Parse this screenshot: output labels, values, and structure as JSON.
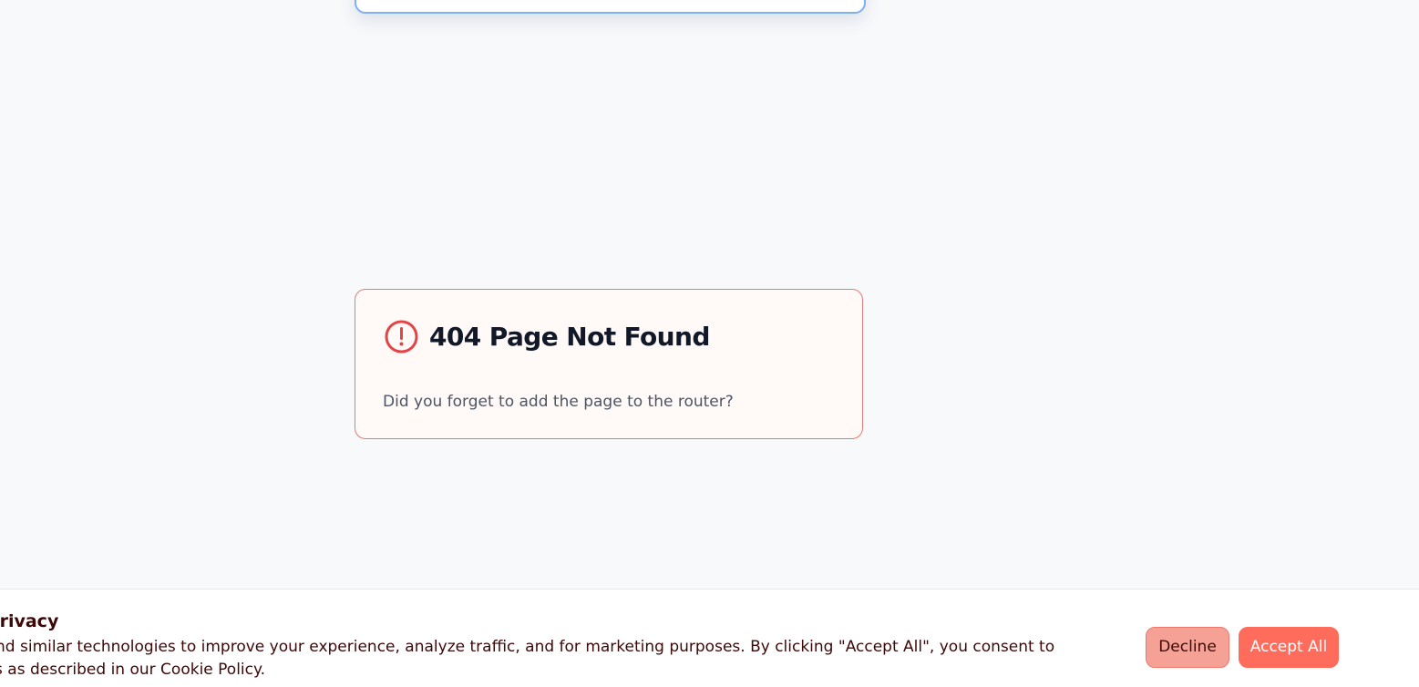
{
  "error_page": {
    "title": "404 Page Not Found",
    "message": "Did you forget to add the page to the router?",
    "icon": "alert-circle-icon"
  },
  "cookie_banner": {
    "title": "r privacy",
    "body": "We use cookies and similar technologies to improve your experience, analyze traffic, and for marketing purposes. By clicking \"Accept All\", you consent to our use of cookies as described in our Cookie Policy.",
    "decline_label": "Decline",
    "accept_all_label": "Accept All"
  },
  "colors": {
    "page_background": "#f8f9fb",
    "error_border": "#e07b78",
    "error_icon": "#e24545",
    "primary_button": "#ff6c5c",
    "secondary_button": "#f6a196"
  }
}
